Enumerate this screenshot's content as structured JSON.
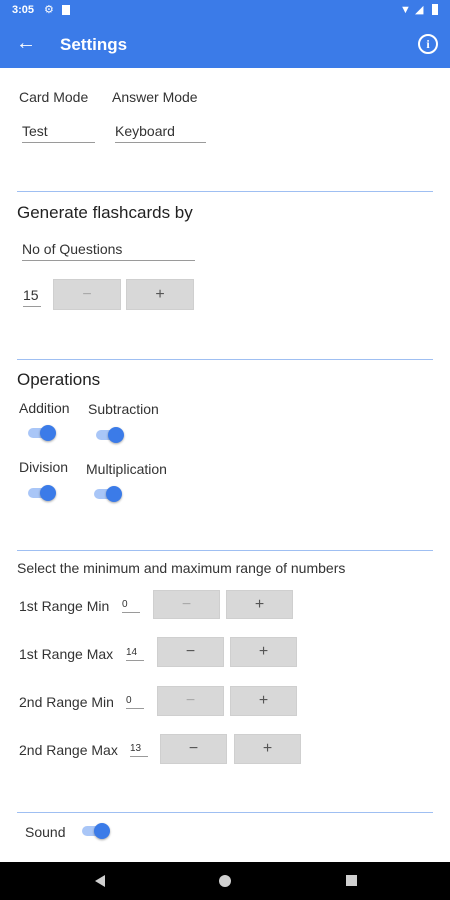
{
  "status_bar": {
    "time": "3:05",
    "icons": [
      "gear-icon",
      "sim-card-icon",
      "wifi-icon",
      "signal-icon",
      "battery-icon"
    ]
  },
  "app_bar": {
    "title": "Settings",
    "back_icon": "arrow-left-icon",
    "info_icon": "info-icon"
  },
  "card_settings": {
    "card_mode_label": "Card Mode",
    "card_mode_value": "Test",
    "answer_mode_label": "Answer Mode",
    "answer_mode_value": "Keyboard"
  },
  "generate": {
    "heading": "Generate flashcards by",
    "select_value": "No of Questions",
    "count_value": "15",
    "minus": "−",
    "plus": "+"
  },
  "operations": {
    "heading": "Operations",
    "items": [
      {
        "label": "Addition",
        "on": true
      },
      {
        "label": "Subtraction",
        "on": true
      },
      {
        "label": "Division",
        "on": true
      },
      {
        "label": "Multiplication",
        "on": true
      }
    ]
  },
  "ranges": {
    "heading": "Select the minimum and maximum range of numbers",
    "minus": "−",
    "plus": "+",
    "rows": [
      {
        "label": "1st Range Min",
        "value": "0"
      },
      {
        "label": "1st Range Max",
        "value": "14"
      },
      {
        "label": "2nd Range Min",
        "value": "0"
      },
      {
        "label": "2nd Range Max",
        "value": "13"
      }
    ]
  },
  "sound": {
    "label": "Sound",
    "on": true
  },
  "nav_bar": {
    "icons": [
      "back-triangle-icon",
      "home-circle-icon",
      "recents-square-icon"
    ]
  },
  "colors": {
    "primary": "#3b7be8",
    "divider": "#9fbff2",
    "button": "#d8d8d8"
  }
}
